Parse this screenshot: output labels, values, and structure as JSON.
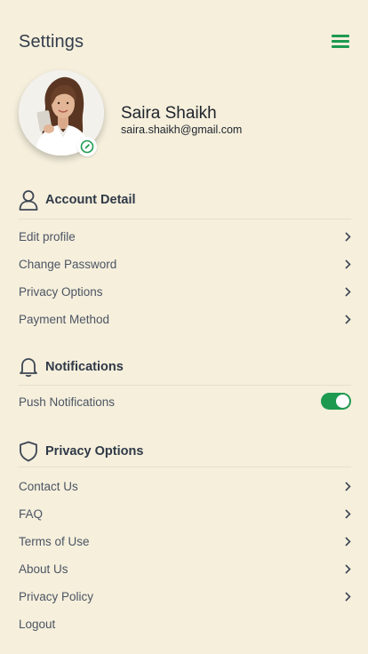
{
  "header": {
    "title": "Settings",
    "menu_icon": "hamburger-menu-icon"
  },
  "profile": {
    "name": "Saira Shaikh",
    "email": "saira.shaikh@gmail.com",
    "edit_icon": "edit-pencil-icon"
  },
  "sections": {
    "account": {
      "title": "Account Detail",
      "icon": "user-icon",
      "items": [
        {
          "label": "Edit profile"
        },
        {
          "label": "Change Password"
        },
        {
          "label": "Privacy Options"
        },
        {
          "label": "Payment Method"
        }
      ]
    },
    "notifications": {
      "title": "Notifications",
      "icon": "bell-icon",
      "items": [
        {
          "label": "Push Notifications",
          "enabled": true
        }
      ]
    },
    "privacy": {
      "title": "Privacy Options",
      "icon": "shield-icon",
      "items": [
        {
          "label": "Contact Us"
        },
        {
          "label": "FAQ"
        },
        {
          "label": "Terms of Use"
        },
        {
          "label": "About Us"
        },
        {
          "label": "Privacy Policy"
        },
        {
          "label": "Logout"
        }
      ]
    }
  },
  "colors": {
    "background": "#f5efdc",
    "accent": "#1d9a50",
    "text": "#333d4b"
  }
}
